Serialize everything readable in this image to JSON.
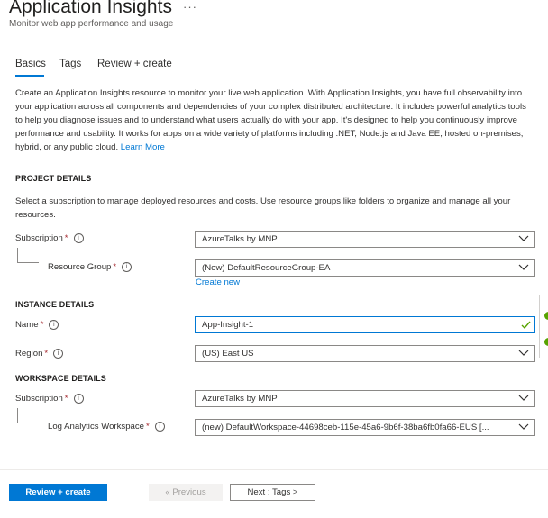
{
  "header": {
    "title": "Application Insights",
    "more": "···",
    "subtitle": "Monitor web app performance and usage"
  },
  "tabs": [
    {
      "label": "Basics",
      "selected": true
    },
    {
      "label": "Tags",
      "selected": false
    },
    {
      "label": "Review + create",
      "selected": false
    }
  ],
  "description": {
    "text": "Create an Application Insights resource to monitor your live web application. With Application Insights, you have full observability into your application across all components and dependencies of your complex distributed architecture. It includes powerful analytics tools to help you diagnose issues and to understand what users actually do with your app. It's designed to help you continuously improve performance and usability. It works for apps on a wide variety of platforms including .NET, Node.js and Java EE, hosted on-premises, hybrid, or any public cloud.",
    "learn_more": "Learn More"
  },
  "project_details": {
    "heading": "PROJECT DETAILS",
    "help": "Select a subscription to manage deployed resources and costs. Use resource groups like folders to organize and manage all your resources.",
    "subscription_label": "Subscription",
    "subscription_value": "AzureTalks by MNP",
    "resource_group_label": "Resource Group",
    "resource_group_value": "(New) DefaultResourceGroup-EA",
    "create_new": "Create new"
  },
  "instance_details": {
    "heading": "INSTANCE DETAILS",
    "name_label": "Name",
    "name_value": "App-Insight-1",
    "region_label": "Region",
    "region_value": "(US) East US"
  },
  "workspace_details": {
    "heading": "WORKSPACE DETAILS",
    "subscription_label": "Subscription",
    "subscription_value": "AzureTalks by MNP",
    "workspace_label": "Log Analytics Workspace",
    "workspace_value": "(new) DefaultWorkspace-44698ceb-115e-45a6-9b6f-38ba6fb0fa66-EUS [..."
  },
  "common": {
    "required_mark": "*",
    "info_glyph": "i"
  },
  "footer": {
    "review_create": "Review + create",
    "previous": "« Previous",
    "next": "Next : Tags >"
  },
  "colors": {
    "accent": "#0078d4",
    "required": "#a4262c",
    "valid": "#57a300"
  }
}
